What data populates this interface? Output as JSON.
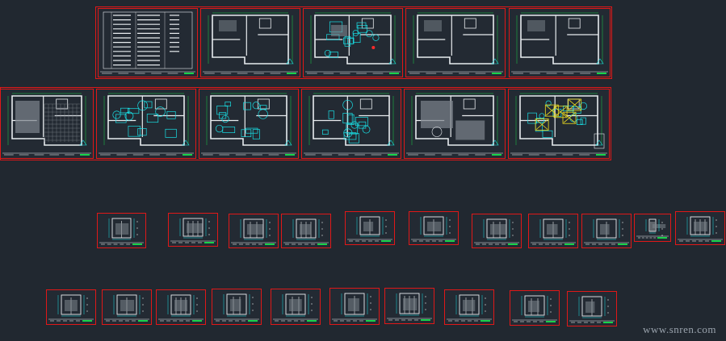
{
  "watermark": "www.snren.com",
  "colors": {
    "background": "#212830",
    "frame": "#e01818",
    "cyan": "#19e0e6",
    "white": "#e8ecef",
    "green": "#19d24a",
    "yellow": "#f0e020",
    "red": "#ff2a2a",
    "grey": "#7d858d"
  },
  "sheets_row1": [
    "title-list",
    "floor-plan",
    "floor-plan-detailed",
    "floor-plan",
    "floor-plan"
  ],
  "sheets_row2": [
    "floor-plan-grid",
    "furniture-plan",
    "ceiling-plan",
    "furniture-plan",
    "floor-plan-grey",
    "lighting-plan"
  ],
  "sheets_row3": [
    "elevation",
    "elevation",
    "elevation",
    "elevation",
    "elevation",
    "elevation",
    "elevation",
    "elevation",
    "elevation",
    "elevation",
    "elevation"
  ],
  "sheets_row4": [
    "elevation",
    "elevation",
    "elevation",
    "elevation",
    "elevation",
    "elevation",
    "elevation",
    "elevation",
    "elevation",
    "elevation"
  ]
}
